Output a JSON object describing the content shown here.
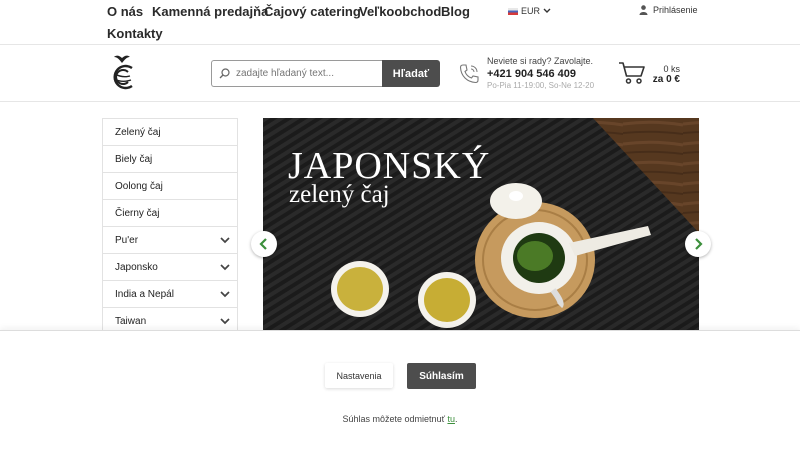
{
  "nav": {
    "links": [
      "O nás",
      "Kamenná predajňa",
      "Čajový catering",
      "Veľkoobchod",
      "Blog",
      "Kontakty"
    ],
    "currency": "EUR",
    "login": "Prihlásenie"
  },
  "search": {
    "placeholder": "zadajte hľadaný text...",
    "button": "Hľadať"
  },
  "contact": {
    "question": "Neviete si rady? Zavolajte.",
    "phone": "+421 904 546 409",
    "hours": "Po-Pia 11-19:00, So-Ne 12-20"
  },
  "cart": {
    "count": "0 ks",
    "total": "za 0 €"
  },
  "categories": [
    {
      "label": "Zelený čaj",
      "expandable": false
    },
    {
      "label": "Biely čaj",
      "expandable": false
    },
    {
      "label": "Oolong čaj",
      "expandable": false
    },
    {
      "label": "Čierny čaj",
      "expandable": false
    },
    {
      "label": "Pu'er",
      "expandable": true
    },
    {
      "label": "Japonsko",
      "expandable": true
    },
    {
      "label": "India a Nepál",
      "expandable": true
    },
    {
      "label": "Taiwan",
      "expandable": true
    }
  ],
  "banner": {
    "title": "JAPONSKÝ",
    "subtitle": "zelený čaj"
  },
  "cookie": {
    "settings_label": "Nastavenia",
    "agree_label": "Súhlasím",
    "note_prefix": "Súhlas môžete odmietnuť ",
    "note_link": "tu",
    "note_suffix": "."
  },
  "colors": {
    "accent_green": "#3c8f3c",
    "dark_button": "#4d4d4d"
  },
  "icons": {
    "search": "search-icon",
    "phone": "phone-icon",
    "cart": "cart-icon",
    "user": "user-icon",
    "chevron": "chevron-down-icon",
    "prev": "arrow-left-icon",
    "next": "arrow-right-icon"
  }
}
